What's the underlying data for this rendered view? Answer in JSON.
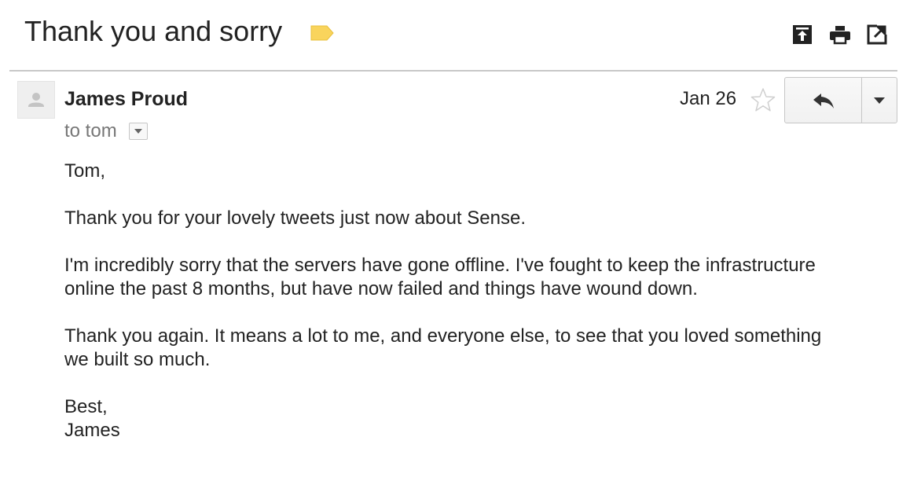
{
  "thread": {
    "subject": "Thank you and sorry",
    "label_color": "#f9d45c",
    "toolbar_icons": [
      "archive-icon",
      "print-icon",
      "open-in-new-window-icon"
    ]
  },
  "message": {
    "sender_name": "James Proud",
    "recipients": "to tom",
    "date": "Jan 26",
    "starred": false,
    "icons": {
      "avatar": "person-avatar-icon",
      "star": "star-outline-icon",
      "reply": "reply-arrow-icon",
      "more": "dropdown-triangle-icon"
    },
    "body": {
      "greeting": "Tom,",
      "p1": "Thank you for your lovely tweets just now about Sense.",
      "p2_line1": "I'm incredibly sorry that the servers have gone offline. I've fought to keep the infrastructure",
      "p2_line2": "online the past 8 months, but have now failed and things have wound down.",
      "p3_line1": "Thank you again. It means a lot to me, and everyone else, to see that you loved something",
      "p3_line2": "we built so much.",
      "signoff": "Best,",
      "signature": "James"
    }
  }
}
